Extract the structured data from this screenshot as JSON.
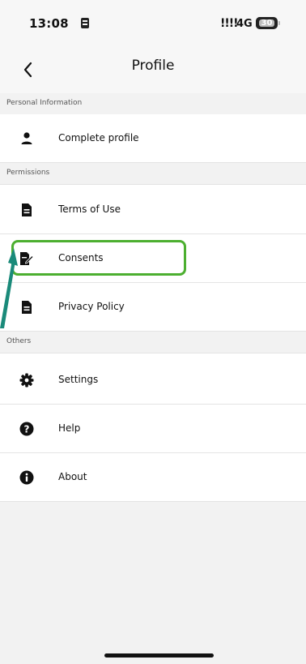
{
  "status_bar": {
    "time": "13:08",
    "signal": "!!!!",
    "network": "4G",
    "battery": "30"
  },
  "header": {
    "title": "Profile"
  },
  "sections": [
    {
      "title": "Personal Information",
      "items": [
        {
          "label": "Complete profile",
          "icon": "person-icon"
        }
      ]
    },
    {
      "title": "Permissions",
      "items": [
        {
          "label": "Terms of Use",
          "icon": "document-icon"
        },
        {
          "label": "Consents",
          "icon": "signed-document-icon"
        },
        {
          "label": "Privacy Policy",
          "icon": "document-icon"
        }
      ]
    },
    {
      "title": "Others",
      "items": [
        {
          "label": "Settings",
          "icon": "gear-icon"
        },
        {
          "label": "Help",
          "icon": "question-icon"
        },
        {
          "label": "About",
          "icon": "info-icon"
        }
      ]
    }
  ],
  "colors": {
    "highlight": "#4caf30",
    "arrow": "#1a8a7a"
  }
}
